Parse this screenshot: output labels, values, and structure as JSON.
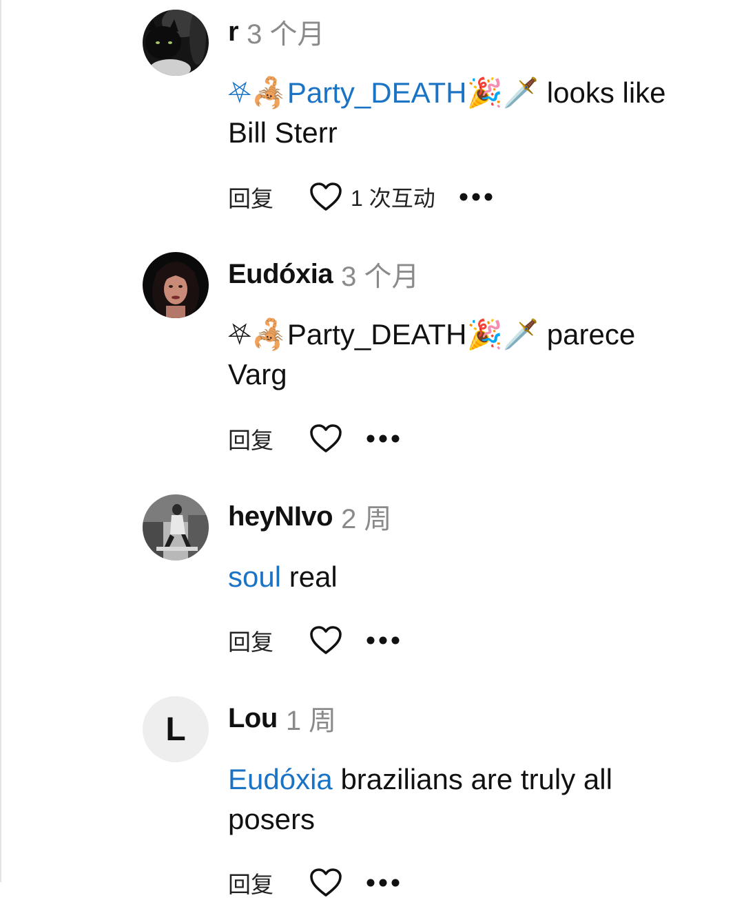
{
  "colors": {
    "mention": "#1a73c4",
    "time": "#8a8a8a",
    "text": "#111111",
    "avatar_bg": "#eeeeee"
  },
  "comments": [
    {
      "author": "r",
      "time": "3 个月",
      "mention": "⛧🦂Party_DEATH🎉🗡️",
      "text": " looks like Bill Sterr",
      "reply": "回复",
      "interactions": "1 次互动",
      "avatar": "dark-cat-photo"
    },
    {
      "author": "Eudóxia",
      "time": "3 个月",
      "prefix": "⛧🦂Party_DEATH🎉🗡️",
      "text": " parece Varg",
      "reply": "回复",
      "avatar": "woman-portrait-photo"
    },
    {
      "author": "heyNIvo",
      "time": "2 周",
      "mention": "soul",
      "text": " real",
      "reply": "回复",
      "avatar": "bw-seated-person-photo"
    },
    {
      "author": "Lou",
      "time": "1 周",
      "mention": "Eudóxia",
      "text": " brazilians are truly all posers",
      "reply": "回复",
      "avatar_letter": "L"
    }
  ]
}
